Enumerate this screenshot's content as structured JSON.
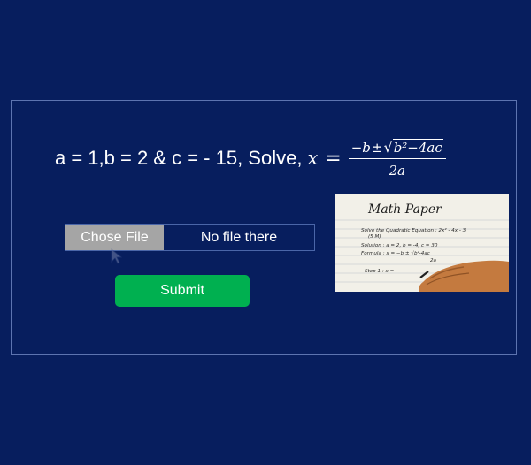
{
  "equation": {
    "prefix": "a = 1,b = 2 & c = - 15, Solve,",
    "variable": "x",
    "equals": "=",
    "numerator_lead": "−b",
    "numerator_pm": "±",
    "sqrt_symbol": "√",
    "radicand": "b²−4ac",
    "denominator": "2a"
  },
  "upload": {
    "choose_label": "Chose File",
    "status": "No file there"
  },
  "submit": {
    "label": "Submit"
  },
  "preview": {
    "title": "Math Paper",
    "lines": [
      "Solve the Quadratic Equation : 2x² - 4x - 3",
      "(5 M)",
      "Solution : a = 2, b = -4, c = 30",
      "Formula : x = −b ± √b²-4ac",
      "2a",
      "Step 1 : x ="
    ]
  },
  "colors": {
    "background": "#071e5e",
    "chooser_button": "#a5a5a5",
    "submit_button": "#00b050",
    "text": "#ffffff",
    "panel_border": "#5d74b0"
  },
  "icons": {
    "cursor": "mouse-pointer-icon"
  }
}
